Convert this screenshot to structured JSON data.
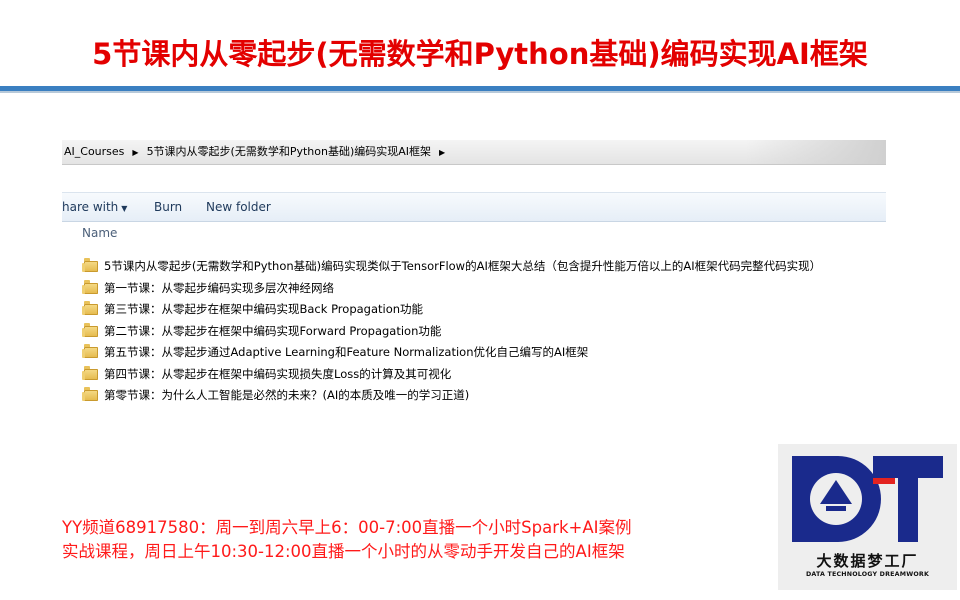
{
  "slide": {
    "title": "5节课内从零起步(无需数学和Python基础)编码实现AI框架"
  },
  "explorer": {
    "breadcrumb": [
      "AI_Courses",
      "5节课内从零起步(无需数学和Python基础)编码实现AI框架"
    ],
    "toolbar": {
      "share_label": "hare with",
      "burn_label": "Burn",
      "new_folder_label": "New folder"
    },
    "column_header": "Name",
    "files": [
      {
        "name": "5节课内从零起步(无需数学和Python基础)编码实现类似于TensorFlow的AI框架大总结（包含提升性能万倍以上的AI框架代码完整代码实现）",
        "icon": "folder-icon"
      },
      {
        "name": "第一节课：从零起步编码实现多层次神经网络",
        "icon": "folder-icon"
      },
      {
        "name": "第三节课：从零起步在框架中编码实现Back Propagation功能",
        "icon": "folder-icon"
      },
      {
        "name": "第二节课：从零起步在框架中编码实现Forward Propagation功能",
        "icon": "folder-icon"
      },
      {
        "name": "第五节课：从零起步通过Adaptive Learning和Feature Normalization优化自己编写的AI框架",
        "icon": "folder-icon"
      },
      {
        "name": "第四节课：从零起步在框架中编码实现损失度Loss的计算及其可视化",
        "icon": "folder-icon"
      },
      {
        "name": "第零节课：为什么人工智能是必然的未来？(AI的本质及唯一的学习正道)",
        "icon": "folder-icon"
      }
    ]
  },
  "announcement": {
    "line1": "YY频道68917580：周一到周六早上6：00-7:00直播一个小时Spark+AI案例",
    "line2": "实战课程，周日上午10:30-12:00直播一个小时的从零动手开发自己的AI框架"
  },
  "logo": {
    "name": "大数据梦工厂",
    "subtitle": "DATA TECHNOLOGY DREAMWORK",
    "letter": "T",
    "colors": {
      "navy": "#1a2a8c",
      "red": "#e32320",
      "background": "#eeeeee"
    }
  },
  "colors": {
    "title_red": "#e30000",
    "rule_blue": "#3a7fc1",
    "announce_red": "#ff1a1a"
  }
}
